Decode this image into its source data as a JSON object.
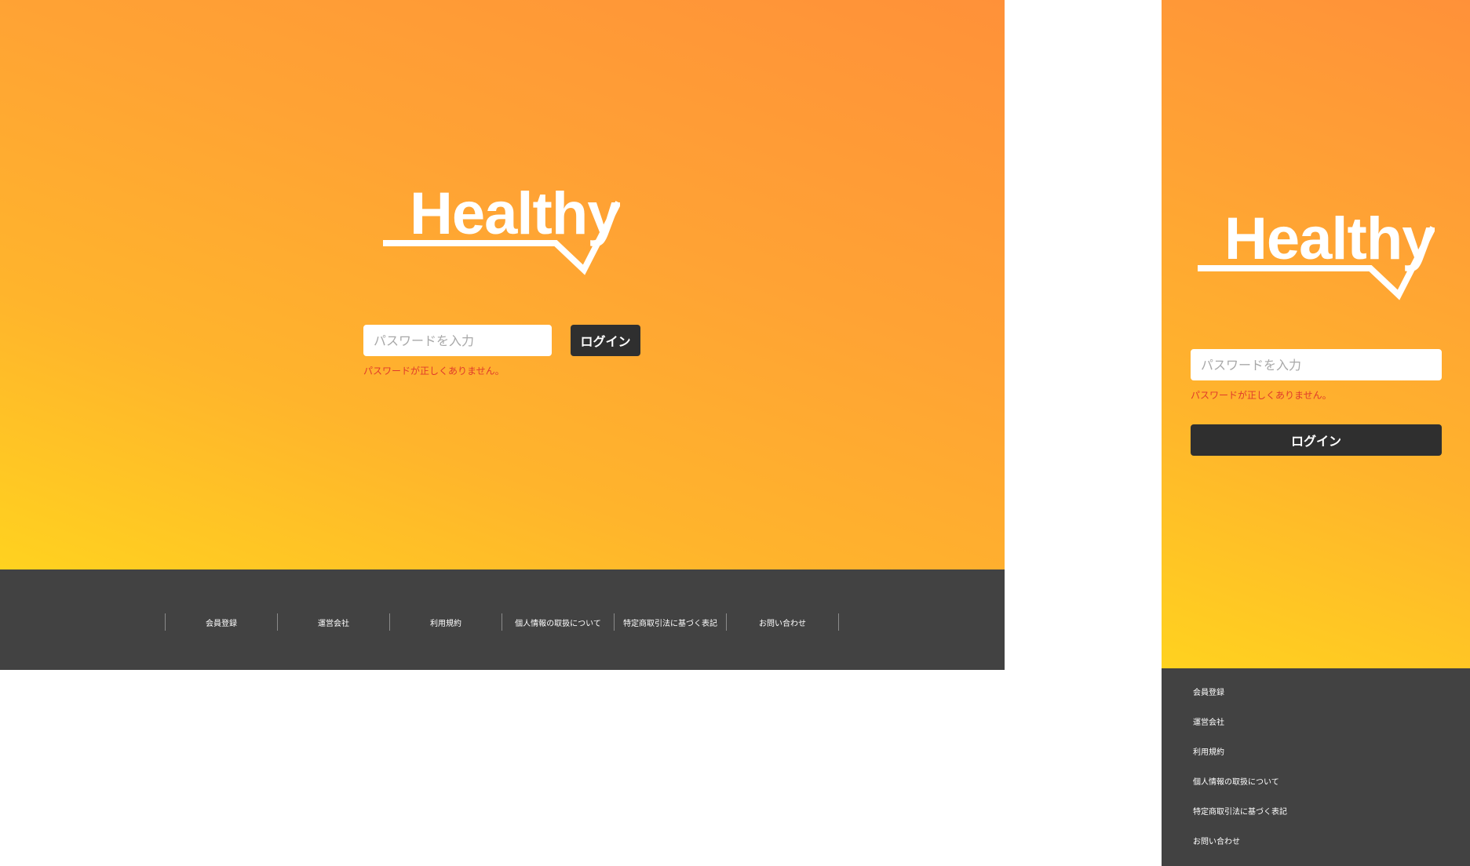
{
  "brand": {
    "logo_text": "Healthy",
    "logo_color": "#ffffff"
  },
  "colors": {
    "gradient_top": "#ff9139",
    "gradient_bottom": "#ffd21f",
    "footer_bg": "#424242",
    "button_bg": "#2f2f2f",
    "error_text": "#e03a2b"
  },
  "login": {
    "password_placeholder": "パスワードを入力",
    "password_value": "",
    "button_label": "ログイン",
    "error_message": "パスワードが正しくありません。"
  },
  "footer": {
    "links": [
      {
        "label": "会員登録"
      },
      {
        "label": "運営会社"
      },
      {
        "label": "利用規約"
      },
      {
        "label": "個人情報の取扱について"
      },
      {
        "label": "特定商取引法に基づく表記"
      },
      {
        "label": "お問い合わせ"
      }
    ]
  }
}
